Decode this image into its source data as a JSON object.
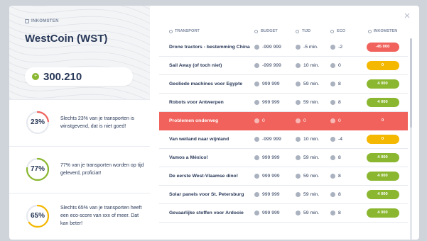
{
  "close_icon": "×",
  "coin": {
    "tag": "INKOMSTEN",
    "name": "WestCoin (WST)",
    "balance": "300.210",
    "coin_symbol": "+"
  },
  "stats": [
    {
      "pct": "23%",
      "value": 23,
      "color": "#f0625b",
      "text": "Slechts 23% van je transporten is winstgevend, dat is niet goed!"
    },
    {
      "pct": "77%",
      "value": 77,
      "color": "#8ab72f",
      "text": "77% van je transporten worden op tijd geleverd, proficiat!"
    },
    {
      "pct": "65%",
      "value": 65,
      "color": "#f5b800",
      "text": "Slechts 65% van je transporten heeft een eco-score van xxx of meer. Dat kan beter!"
    }
  ],
  "table": {
    "headers": {
      "transport": "TRANSPORT",
      "budget": "BUDGET",
      "tijd": "TIJD",
      "eco": "ECO",
      "inkomsten": "INKOMSTEN"
    },
    "rows": [
      {
        "name": "Drone tractors - bestemming China",
        "budget": "-999 999",
        "tijd": "-5 min.",
        "eco": "-2",
        "inkomsten": "-45 000",
        "pill_color": "#f0625b"
      },
      {
        "name": "Sail Away (of toch niet)",
        "budget": "-999 999",
        "tijd": "10 min.",
        "eco": "0",
        "inkomsten": "0",
        "pill_color": "#f5b800"
      },
      {
        "name": "Geoliede machines voor Egypte",
        "budget": "999 999",
        "tijd": "59 min.",
        "eco": "8",
        "inkomsten": "4 000",
        "pill_color": "#8ab72f"
      },
      {
        "name": "Robots voor Antwerpen",
        "budget": "999 999",
        "tijd": "59 min.",
        "eco": "8",
        "inkomsten": "4 000",
        "pill_color": "#8ab72f"
      },
      {
        "name": "Problemen onderweg",
        "budget": "0",
        "tijd": "0",
        "eco": "0",
        "inkomsten": "0",
        "alert": true
      },
      {
        "name": "Van weiland naar wijnland",
        "budget": "-999 999",
        "tijd": "10 min.",
        "eco": "-4",
        "inkomsten": "0",
        "pill_color": "#f5b800"
      },
      {
        "name": "Vamos a México!",
        "budget": "999 999",
        "tijd": "59 min.",
        "eco": "8",
        "inkomsten": "4 000",
        "pill_color": "#8ab72f"
      },
      {
        "name": "De eerste West-Vlaamse dino!",
        "budget": "999 999",
        "tijd": "59 min.",
        "eco": "8",
        "inkomsten": "4 000",
        "pill_color": "#8ab72f"
      },
      {
        "name": "Solar panels voor St. Petersburg",
        "budget": "999 999",
        "tijd": "59 min.",
        "eco": "8",
        "inkomsten": "4 000",
        "pill_color": "#8ab72f"
      },
      {
        "name": "Gevaarlijke stoffen voor Ardooie",
        "budget": "999 999",
        "tijd": "59 min.",
        "eco": "8",
        "inkomsten": "4 000",
        "pill_color": "#8ab72f"
      }
    ]
  }
}
